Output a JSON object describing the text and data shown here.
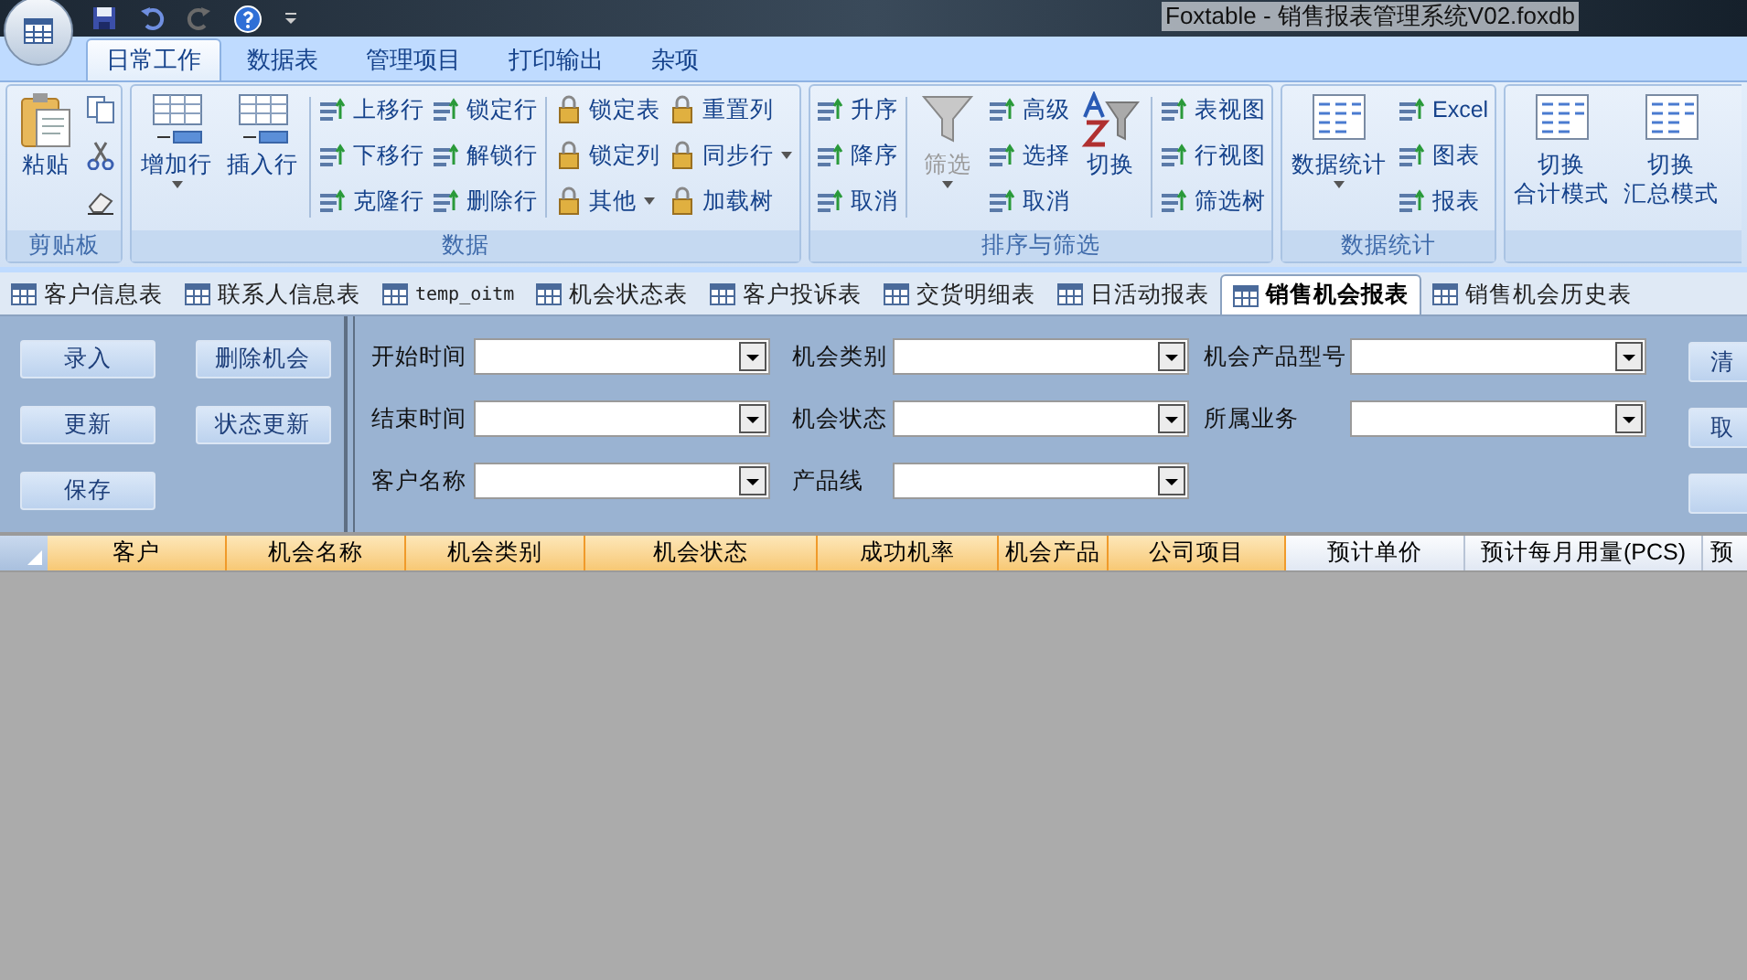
{
  "window": {
    "title": "Foxtable - 销售报表管理系统V02.foxdb"
  },
  "ribbon_tabs": [
    {
      "label": "日常工作",
      "selected": true
    },
    {
      "label": "数据表",
      "selected": false
    },
    {
      "label": "管理项目",
      "selected": false
    },
    {
      "label": "打印输出",
      "selected": false
    },
    {
      "label": "杂项",
      "selected": false
    }
  ],
  "ribbon_groups": [
    {
      "label": "剪贴板",
      "columns": [
        {
          "kind": "large",
          "lines": [
            "粘贴"
          ],
          "dropdown": false,
          "disabled": false
        },
        {
          "kind": "stack",
          "items": [
            {
              "dropdown": false
            },
            {
              "dropdown": false
            },
            {
              "dropdown": false
            }
          ]
        }
      ]
    },
    {
      "label": "数据",
      "columns": [
        {
          "kind": "large",
          "lines": [
            "增加行"
          ],
          "dropdown": true,
          "disabled": false
        },
        {
          "kind": "large",
          "lines": [
            "插入行"
          ],
          "dropdown": false,
          "disabled": false
        },
        {
          "kind": "sep"
        },
        {
          "kind": "stack",
          "items": [
            {
              "label": "上移行",
              "dropdown": false
            },
            {
              "label": "下移行",
              "dropdown": false
            },
            {
              "label": "克隆行",
              "dropdown": false
            }
          ]
        },
        {
          "kind": "stack",
          "items": [
            {
              "label": "锁定行",
              "dropdown": false
            },
            {
              "label": "解锁行",
              "dropdown": false
            },
            {
              "label": "删除行",
              "dropdown": false
            }
          ]
        },
        {
          "kind": "sep"
        },
        {
          "kind": "stack",
          "items": [
            {
              "label": "锁定表",
              "dropdown": false
            },
            {
              "label": "锁定列",
              "dropdown": false
            },
            {
              "label": "其他",
              "dropdown": true
            }
          ]
        },
        {
          "kind": "stack",
          "items": [
            {
              "label": "重置列",
              "dropdown": false
            },
            {
              "label": "同步行",
              "dropdown": true
            },
            {
              "label": "加载树",
              "dropdown": false
            }
          ]
        }
      ]
    },
    {
      "label": "排序与筛选",
      "columns": [
        {
          "kind": "stack",
          "items": [
            {
              "label": "升序",
              "dropdown": false
            },
            {
              "label": "降序",
              "dropdown": false
            },
            {
              "label": "取消",
              "dropdown": false
            }
          ]
        },
        {
          "kind": "sep"
        },
        {
          "kind": "large",
          "lines": [
            "筛选"
          ],
          "dropdown": true,
          "disabled": true
        },
        {
          "kind": "stack",
          "items": [
            {
              "label": "高级",
              "dropdown": false
            },
            {
              "label": "选择",
              "dropdown": false
            },
            {
              "label": "取消",
              "dropdown": false
            }
          ]
        },
        {
          "kind": "large",
          "lines": [
            "切换"
          ],
          "dropdown": false,
          "disabled": false
        },
        {
          "kind": "sep"
        },
        {
          "kind": "stack",
          "items": [
            {
              "label": "表视图",
              "dropdown": false
            },
            {
              "label": "行视图",
              "dropdown": false
            },
            {
              "label": "筛选树",
              "dropdown": false
            }
          ]
        }
      ]
    },
    {
      "label": "数据统计",
      "columns": [
        {
          "kind": "large",
          "lines": [
            "数据统计"
          ],
          "dropdown": true,
          "disabled": false
        },
        {
          "kind": "stack",
          "items": [
            {
              "label": "Excel",
              "dropdown": false
            },
            {
              "label": "图表",
              "dropdown": false
            },
            {
              "label": "报表",
              "dropdown": false
            }
          ]
        }
      ]
    },
    {
      "columns": [
        {
          "kind": "large",
          "lines": [
            "切换",
            "合计模式"
          ],
          "dropdown": false,
          "disabled": false
        },
        {
          "kind": "large",
          "lines": [
            "切换",
            "汇总模式"
          ],
          "dropdown": false,
          "disabled": false
        }
      ]
    }
  ],
  "table_tabs": [
    {
      "label": "客户信息表",
      "selected": false
    },
    {
      "label": "联系人信息表",
      "selected": false
    },
    {
      "label": "temp_oitm",
      "selected": false
    },
    {
      "label": "机会状态表",
      "selected": false
    },
    {
      "label": "客户投诉表",
      "selected": false
    },
    {
      "label": "交货明细表",
      "selected": false
    },
    {
      "label": "日活动报表",
      "selected": false
    },
    {
      "label": "销售机会报表",
      "selected": true
    },
    {
      "label": "销售机会历史表",
      "selected": false
    }
  ],
  "action_buttons": [
    "录入",
    "删除机会",
    "更新",
    "状态更新",
    "保存"
  ],
  "filters": [
    {
      "label": "开始时间"
    },
    {
      "label": "机会类别"
    },
    {
      "label": "机会产品型号"
    },
    {
      "label": "结束时间"
    },
    {
      "label": "机会状态"
    },
    {
      "label": "所属业务"
    },
    {
      "label": "客户名称"
    },
    {
      "label": "产品线"
    }
  ],
  "side_buttons": [
    "清",
    "取"
  ],
  "grid_columns": [
    {
      "label": "客户",
      "selected": true
    },
    {
      "label": "机会名称",
      "selected": true
    },
    {
      "label": "机会类别",
      "selected": true
    },
    {
      "label": "机会状态",
      "selected": true
    },
    {
      "label": "成功机率",
      "selected": true
    },
    {
      "label": "机会产品",
      "selected": true
    },
    {
      "label": "公司项目",
      "selected": true
    },
    {
      "label": "预计单价",
      "selected": false
    },
    {
      "label": "预计每月用量(PCS)",
      "selected": false
    },
    {
      "label": "预",
      "selected": false
    }
  ]
}
